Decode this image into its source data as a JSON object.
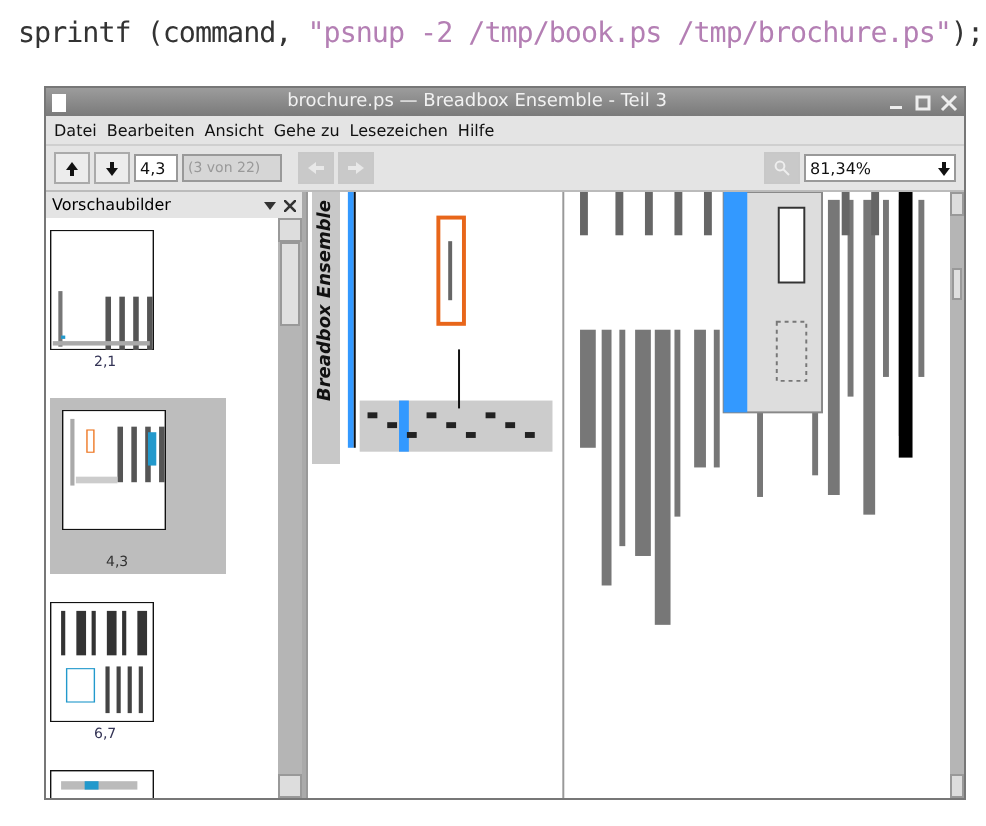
{
  "code_line": [
    {
      "kind": "plain",
      "text": "sprintf (command, "
    },
    {
      "kind": "string",
      "text": "\"psnup -2 /tmp/book.ps /tmp/brochure.ps\""
    },
    {
      "kind": "plain",
      "text": ");"
    }
  ],
  "window": {
    "title": "brochure.ps — Breadbox Ensemble - Teil 3"
  },
  "menu": [
    "Datei",
    "Bearbeiten",
    "Ansicht",
    "Gehe zu",
    "Lesezeichen",
    "Hilfe"
  ],
  "toolbar": {
    "page": "4,3",
    "page_count": "(3 von 22)",
    "zoom": "81,34%"
  },
  "sidebar": {
    "title": "Vorschaubilder",
    "thumbnails": [
      {
        "label": "2,1",
        "selected": false
      },
      {
        "label": "4,3",
        "selected": true
      },
      {
        "label": "6,7",
        "selected": false
      },
      {
        "selected": false
      }
    ]
  },
  "document": {
    "header": "Breadbox Ensemble"
  }
}
